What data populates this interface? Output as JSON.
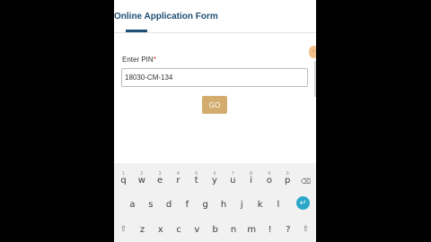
{
  "header": {
    "title": "Online Application Form"
  },
  "form": {
    "pin_label": "Enter PIN",
    "required_mark": "*",
    "pin_value": "18030-CM-134",
    "go_label": "GO"
  },
  "keyboard": {
    "row1": [
      {
        "num": "1",
        "ch": "q"
      },
      {
        "num": "2",
        "ch": "w"
      },
      {
        "num": "3",
        "ch": "e"
      },
      {
        "num": "4",
        "ch": "r"
      },
      {
        "num": "5",
        "ch": "t"
      },
      {
        "num": "6",
        "ch": "y"
      },
      {
        "num": "7",
        "ch": "u"
      },
      {
        "num": "8",
        "ch": "i"
      },
      {
        "num": "9",
        "ch": "o"
      },
      {
        "num": "0",
        "ch": "p"
      }
    ],
    "row2": [
      "a",
      "s",
      "d",
      "f",
      "g",
      "h",
      "j",
      "k",
      "l"
    ],
    "row3": [
      "z",
      "x",
      "c",
      "v",
      "b",
      "n",
      "m",
      "!",
      "?"
    ],
    "delete_icon": "⌫",
    "shift_icon": "⇧",
    "enter_icon": "↵",
    "accent_enter": "#2aa7c9"
  },
  "colors": {
    "title": "#1e4f74",
    "go_button": "#d4ac6e"
  }
}
